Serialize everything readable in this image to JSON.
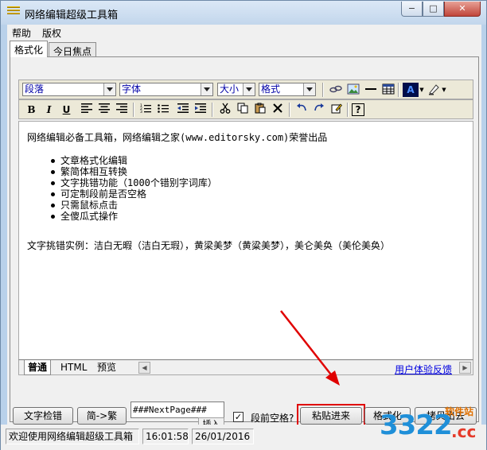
{
  "window": {
    "title": "网络编辑超级工具箱",
    "controls": {
      "minimize": "−",
      "maximize": "□",
      "close": "✕"
    }
  },
  "menubar": {
    "items": [
      "帮助",
      "版权"
    ]
  },
  "tabs": [
    {
      "label": "格式化",
      "active": true
    },
    {
      "label": "今日焦点",
      "active": false
    }
  ],
  "toolbar": {
    "paragraph_select": "段落",
    "font_select": "字体",
    "size_select": "大小",
    "format_select": "格式",
    "icons": [
      "bold-icon",
      "italic-icon",
      "underline-icon",
      "align-left-icon",
      "align-center-icon",
      "align-right-icon",
      "ordered-list-icon",
      "unordered-list-icon",
      "outdent-icon",
      "indent-icon",
      "cut-icon",
      "copy-icon",
      "paste-icon",
      "delete-icon",
      "undo-icon",
      "redo-icon",
      "edit-icon",
      "help-icon",
      "link-icon",
      "image-icon",
      "horizontal-rule-icon",
      "table-icon",
      "font-color-icon",
      "highlight-icon"
    ],
    "bold": "B",
    "italic": "I",
    "underline": "U",
    "font_color_letter": "A"
  },
  "editor": {
    "intro": "网络编辑必备工具箱，网络编辑之家(www.editorsky.com)荣誉出品",
    "features": [
      "文章格式化编辑",
      "繁简体相互转换",
      "文字挑错功能（1000个错别字词库）",
      "可定制段前是否空格",
      "只需鼠标点击",
      "全傻瓜式操作"
    ],
    "example": "文字挑错实例：洁白无暇（洁白无瑕），黄梁美梦（黄粱美梦），美仑美奂（美伦美奂）"
  },
  "viewbar": {
    "tabs": [
      "普通",
      "HTML",
      "预览"
    ],
    "feedback_link": "用户体验反馈"
  },
  "controls": {
    "check_text_button": "文字检错",
    "convert_button": "简->繁",
    "nextpage_value": "###NextPage###",
    "insert_button": "插入",
    "checkbox_checked": "✓",
    "indent_label": "段前空格?",
    "paste_in_button": "粘贴进来",
    "format_button": "格式化",
    "copy_out_button": "拷贝出去"
  },
  "statusbar": {
    "message": "欢迎使用网络编辑超级工具箱",
    "time": "16:01:58",
    "date": "26/01/2016"
  },
  "watermark": {
    "main": "3322",
    "suffix": ".cc",
    "site": "软件站"
  },
  "colors": {
    "title_bg": "#c2d6ec",
    "link": "#0000e0",
    "highlight": "#e00000",
    "select_text": "#0000a8"
  }
}
